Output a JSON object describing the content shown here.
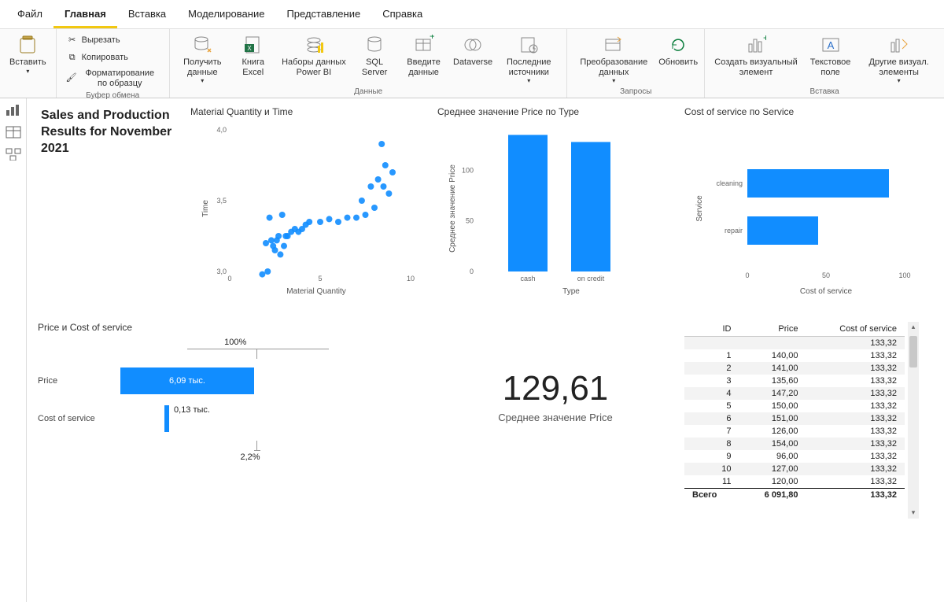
{
  "menubar": {
    "tabs": [
      "Файл",
      "Главная",
      "Вставка",
      "Моделирование",
      "Представление",
      "Справка"
    ],
    "active_index": 1
  },
  "ribbon": {
    "groups": [
      {
        "label": "",
        "items": [
          {
            "name": "paste",
            "label": "Вставить",
            "arrow": true
          }
        ]
      },
      {
        "label": "Буфер обмена",
        "items": [
          {
            "name": "cut",
            "label": "Вырезать",
            "small": true,
            "icon": "cut"
          },
          {
            "name": "copy",
            "label": "Копировать",
            "small": true,
            "icon": "copy"
          },
          {
            "name": "format-painter",
            "label": "Форматирование по образцу",
            "small": true,
            "icon": "brush"
          }
        ]
      },
      {
        "label": "Данные",
        "items": [
          {
            "name": "get-data",
            "label": "Получить данные",
            "arrow": true,
            "icon": "db-arrow"
          },
          {
            "name": "excel",
            "label": "Книга Excel",
            "icon": "excel"
          },
          {
            "name": "pbi-datasets",
            "label": "Наборы данных Power BI",
            "icon": "pbi"
          },
          {
            "name": "sql",
            "label": "SQL Server",
            "icon": "sql"
          },
          {
            "name": "enter-data",
            "label": "Введите данные",
            "icon": "grid"
          },
          {
            "name": "dataverse",
            "label": "Dataverse",
            "icon": "dataverse"
          },
          {
            "name": "recent",
            "label": "Последние источники",
            "arrow": true,
            "icon": "recent"
          }
        ]
      },
      {
        "label": "Запросы",
        "items": [
          {
            "name": "transform",
            "label": "Преобразование данных",
            "arrow": true,
            "icon": "transform"
          },
          {
            "name": "refresh",
            "label": "Обновить",
            "icon": "refresh"
          }
        ]
      },
      {
        "label": "Вставка",
        "items": [
          {
            "name": "new-visual",
            "label": "Создать визуальный элемент",
            "icon": "visual"
          },
          {
            "name": "textbox",
            "label": "Текстовое поле",
            "icon": "text"
          },
          {
            "name": "more-visuals",
            "label": "Другие визуал. элементы",
            "arrow": true,
            "icon": "shapes"
          }
        ]
      }
    ]
  },
  "view_tools": [
    "report-view",
    "data-view",
    "model-view"
  ],
  "page_title": "Sales and Production Results for November 2021",
  "charts": {
    "scatter": {
      "title": "Material Quantity и Time",
      "xlabel": "Material Quantity",
      "ylabel": "Time"
    },
    "bar_type": {
      "title": "Среднее значение Price по Type",
      "ylabel": "Среднее значение Price",
      "xlabel": "Type"
    },
    "bar_service": {
      "title": "Cost of service по Service",
      "ylabel": "Service",
      "xlabel": "Cost of service"
    },
    "funnel": {
      "title": "Price и Cost of service",
      "pct_top": "100%",
      "rows": [
        {
          "label": "Price",
          "value": "6,09 тыс."
        },
        {
          "label": "Cost of service",
          "value": "0,13 тыс."
        }
      ],
      "pct_bot": "2,2%"
    },
    "kpi": {
      "value": "129,61",
      "label": "Среднее значение Price"
    }
  },
  "table": {
    "headers": [
      "ID",
      "Price",
      "Cost of service"
    ],
    "rows": [
      {
        "id": "",
        "price": "",
        "cost": "133,32"
      },
      {
        "id": "1",
        "price": "140,00",
        "cost": "133,32"
      },
      {
        "id": "2",
        "price": "141,00",
        "cost": "133,32"
      },
      {
        "id": "3",
        "price": "135,60",
        "cost": "133,32"
      },
      {
        "id": "4",
        "price": "147,20",
        "cost": "133,32"
      },
      {
        "id": "5",
        "price": "150,00",
        "cost": "133,32"
      },
      {
        "id": "6",
        "price": "151,00",
        "cost": "133,32"
      },
      {
        "id": "7",
        "price": "126,00",
        "cost": "133,32"
      },
      {
        "id": "8",
        "price": "154,00",
        "cost": "133,32"
      },
      {
        "id": "9",
        "price": "96,00",
        "cost": "133,32"
      },
      {
        "id": "10",
        "price": "127,00",
        "cost": "133,32"
      },
      {
        "id": "11",
        "price": "120,00",
        "cost": "133,32"
      }
    ],
    "total": {
      "label": "Всего",
      "price": "6 091,80",
      "cost": "133,32"
    }
  },
  "chart_data": [
    {
      "type": "scatter",
      "title": "Material Quantity и Time",
      "xlabel": "Material Quantity",
      "ylabel": "Time",
      "xlim": [
        0,
        10
      ],
      "ylim": [
        3.0,
        4.0
      ],
      "points": [
        [
          1.8,
          2.98
        ],
        [
          2.0,
          3.2
        ],
        [
          2.1,
          3.0
        ],
        [
          2.2,
          3.38
        ],
        [
          2.3,
          3.22
        ],
        [
          2.4,
          3.18
        ],
        [
          2.5,
          3.15
        ],
        [
          2.6,
          3.22
        ],
        [
          2.7,
          3.25
        ],
        [
          2.8,
          3.12
        ],
        [
          2.9,
          3.4
        ],
        [
          3.0,
          3.18
        ],
        [
          3.1,
          3.25
        ],
        [
          3.2,
          3.25
        ],
        [
          3.4,
          3.28
        ],
        [
          3.6,
          3.3
        ],
        [
          3.8,
          3.28
        ],
        [
          4.0,
          3.3
        ],
        [
          4.2,
          3.33
        ],
        [
          4.4,
          3.35
        ],
        [
          5.0,
          3.35
        ],
        [
          5.5,
          3.37
        ],
        [
          6.0,
          3.35
        ],
        [
          6.5,
          3.38
        ],
        [
          7.0,
          3.38
        ],
        [
          7.3,
          3.5
        ],
        [
          7.5,
          3.4
        ],
        [
          7.8,
          3.6
        ],
        [
          8.0,
          3.45
        ],
        [
          8.2,
          3.65
        ],
        [
          8.4,
          3.9
        ],
        [
          8.5,
          3.6
        ],
        [
          8.6,
          3.75
        ],
        [
          8.8,
          3.55
        ],
        [
          9.0,
          3.7
        ]
      ]
    },
    {
      "type": "bar",
      "title": "Среднее значение Price по Type",
      "xlabel": "Type",
      "ylabel": "Среднее значение Price",
      "categories": [
        "cash",
        "on credit"
      ],
      "values": [
        135,
        128
      ],
      "ylim": [
        0,
        140
      ]
    },
    {
      "type": "bar",
      "orientation": "horizontal",
      "title": "Cost of service по Service",
      "xlabel": "Cost of service",
      "ylabel": "Service",
      "categories": [
        "cleaning",
        "repair"
      ],
      "values": [
        90,
        45
      ],
      "xlim": [
        0,
        100
      ]
    },
    {
      "type": "bar",
      "title": "Price и Cost of service (funnel)",
      "categories": [
        "Price",
        "Cost of service"
      ],
      "values": [
        6090,
        130
      ],
      "pct_of_first": [
        100,
        2.2
      ]
    },
    {
      "type": "table",
      "title": "ID / Price / Cost of service",
      "columns": [
        "ID",
        "Price",
        "Cost of service"
      ],
      "rows": [
        [
          null,
          null,
          133.32
        ],
        [
          1,
          140.0,
          133.32
        ],
        [
          2,
          141.0,
          133.32
        ],
        [
          3,
          135.6,
          133.32
        ],
        [
          4,
          147.2,
          133.32
        ],
        [
          5,
          150.0,
          133.32
        ],
        [
          6,
          151.0,
          133.32
        ],
        [
          7,
          126.0,
          133.32
        ],
        [
          8,
          154.0,
          133.32
        ],
        [
          9,
          96.0,
          133.32
        ],
        [
          10,
          127.0,
          133.32
        ],
        [
          11,
          120.0,
          133.32
        ]
      ],
      "totals": {
        "Price": 6091.8,
        "Cost of service": 133.32
      }
    }
  ]
}
